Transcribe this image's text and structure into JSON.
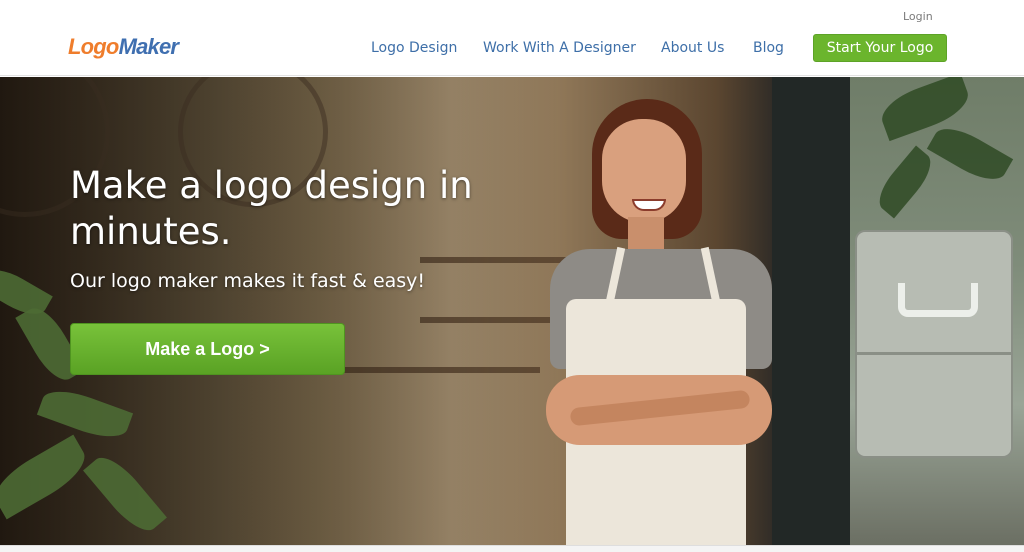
{
  "brand": {
    "logo_part_a": "Logo",
    "logo_part_b": "Maker",
    "colors": {
      "orange": "#ef7d2c",
      "blue": "#3f6fb0",
      "green": "#6bb52d"
    }
  },
  "header": {
    "login_label": "Login",
    "nav": [
      {
        "label": "Logo Design"
      },
      {
        "label": "Work With A Designer"
      },
      {
        "label": "About Us"
      },
      {
        "label": "Blog"
      }
    ],
    "cta_label": "Start Your Logo"
  },
  "hero": {
    "title": "Make a logo design in minutes.",
    "subtitle": "Our logo maker makes it fast & easy!",
    "cta_label": "Make a Logo >",
    "image_description_icon": "shop-owner-photo"
  }
}
